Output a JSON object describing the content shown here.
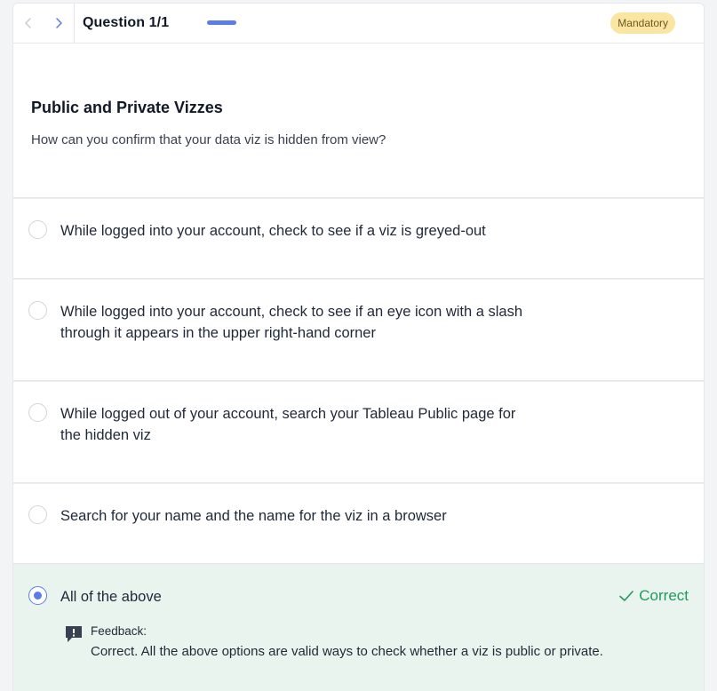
{
  "header": {
    "question_label": "Question 1/1",
    "badge": "Mandatory",
    "progress": 1.0
  },
  "question": {
    "title": "Public and Private Vizzes",
    "prompt": "How can you confirm that your data viz is hidden from view?"
  },
  "options": [
    {
      "line1": "While logged into your account, check to see if a viz is greyed-out",
      "line2": ""
    },
    {
      "line1": "While logged into your account, check to see if an eye icon with a slash",
      "line2": "through it appears in the upper right-hand corner"
    },
    {
      "line1": "While logged out of your account, search your Tableau Public page for",
      "line2": "the hidden viz"
    },
    {
      "line1": "Search for your name and the name for the viz in a browser",
      "line2": ""
    },
    {
      "line1": "All of the above",
      "line2": ""
    }
  ],
  "result": {
    "status": "Correct",
    "feedback_label": "Feedback:",
    "feedback_text": "Correct. All the above options are valid ways to check whether a viz is public or private."
  },
  "colors": {
    "accent": "#5b7de8",
    "correct": "#1f9a5a",
    "badge_bg": "#fbe5a3",
    "selected_bg": "#eaf4ef"
  },
  "icons": [
    "chevron-left-icon",
    "chevron-right-icon",
    "radio-unselected-icon",
    "radio-selected-icon",
    "check-icon",
    "feedback-icon"
  ]
}
